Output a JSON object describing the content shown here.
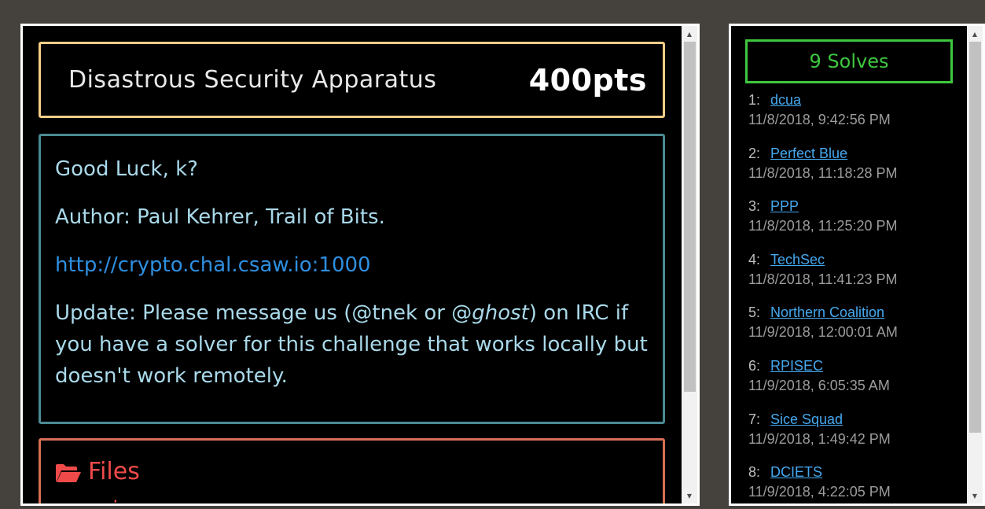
{
  "challenge": {
    "title": "Disastrous Security Apparatus",
    "points": "400pts",
    "description": {
      "greeting": "Good Luck, k?",
      "author": "Author: Paul Kehrer, Trail of Bits.",
      "link": "http://crypto.chal.csaw.io:1000",
      "update_prefix": "Update: Please message us (@tnek or @",
      "update_italic": "ghost",
      "update_suffix": ") on IRC if you have a solver for this challenge that works locally but doesn't work remotely."
    },
    "files": {
      "heading": "Files",
      "icon": "folder-open-icon",
      "items": [
        "main.py"
      ]
    }
  },
  "solves": {
    "heading": "9 Solves",
    "list": [
      {
        "rank": "1:",
        "team": "dcua",
        "time": "11/8/2018, 9:42:56 PM"
      },
      {
        "rank": "2:",
        "team": "Perfect Blue",
        "time": "11/8/2018, 11:18:28 PM"
      },
      {
        "rank": "3:",
        "team": "PPP",
        "time": "11/8/2018, 11:25:20 PM"
      },
      {
        "rank": "4:",
        "team": "TechSec",
        "time": "11/8/2018, 11:41:23 PM"
      },
      {
        "rank": "5:",
        "team": "Northern Coalition",
        "time": "11/9/2018, 12:00:01 AM"
      },
      {
        "rank": "6:",
        "team": "RPISEC",
        "time": "11/9/2018, 6:05:35 AM"
      },
      {
        "rank": "7:",
        "team": "Sice Squad",
        "time": "11/9/2018, 1:49:42 PM"
      },
      {
        "rank": "8:",
        "team": "DCIETS",
        "time": "11/9/2018, 4:22:05 PM"
      }
    ]
  },
  "colors": {
    "background": "#45423e",
    "title_border": "#f6cd86",
    "description_border": "#4b8a93",
    "files_border": "#d86f55",
    "solves_border": "#3ec73e",
    "link": "#2e8fe0",
    "team_link": "#45a8ee"
  }
}
